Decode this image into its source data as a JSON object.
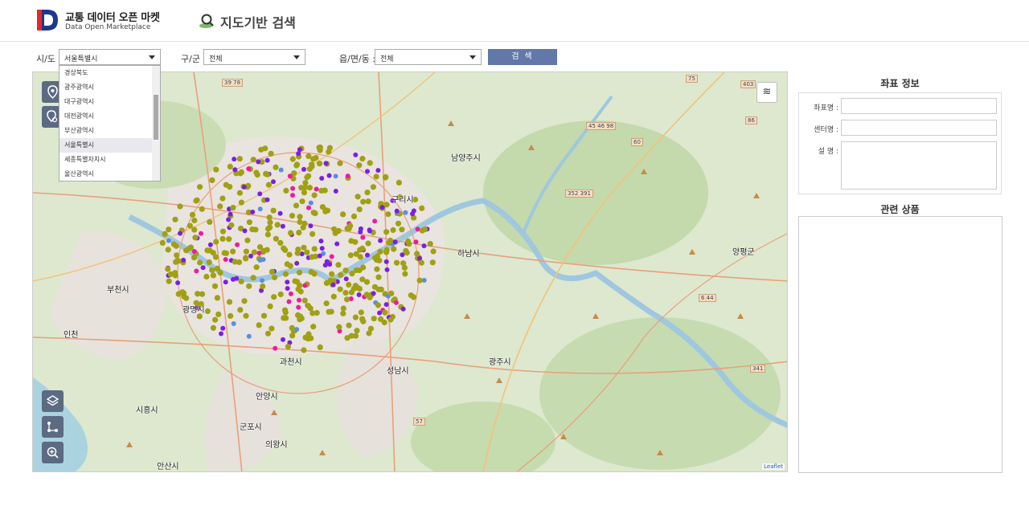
{
  "header": {
    "logo_title": "교통 데이터 오픈 마켓",
    "logo_subtitle": "Data Open Marketplace",
    "page_title": "지도기반 검색"
  },
  "filters": {
    "sido_label": "시/도 :",
    "sido_value": "서울특별시",
    "gugun_label": "구/군 :",
    "gugun_value": "전체",
    "dong_label": "읍/면/동 :",
    "dong_value": "전체",
    "search_button": "검 색"
  },
  "sido_options": [
    "경상북도",
    "광주광역시",
    "대구광역시",
    "대전광역시",
    "부산광역시",
    "서울특별시",
    "세종특별자치시",
    "울산광역시"
  ],
  "sido_selected_index": 5,
  "map": {
    "attribution": "Leaflet",
    "place_labels": [
      "남양주시",
      "구리시",
      "하남시",
      "부천시",
      "광명시",
      "인천",
      "과천시",
      "성남시",
      "광주시",
      "안양시",
      "시흥시",
      "군포시",
      "의왕시",
      "안산시",
      "양평군"
    ],
    "road_shields": [
      "39 78",
      "75",
      "403",
      "86",
      "45 46 98",
      "60",
      "352 391",
      "6 44",
      "341",
      "57"
    ],
    "marker_colors": {
      "olive": "#a0a014",
      "purple": "#7a1fe6",
      "magenta": "#ee1aa0",
      "blue": "#5a8ee0"
    },
    "layer_toggle_icon": "layers-icon"
  },
  "panel": {
    "coord_heading": "좌표 정보",
    "coord_name_label": "좌표명 :",
    "center_name_label": "센터명 :",
    "description_label": "설 명 :",
    "products_heading": "관련 상품"
  }
}
